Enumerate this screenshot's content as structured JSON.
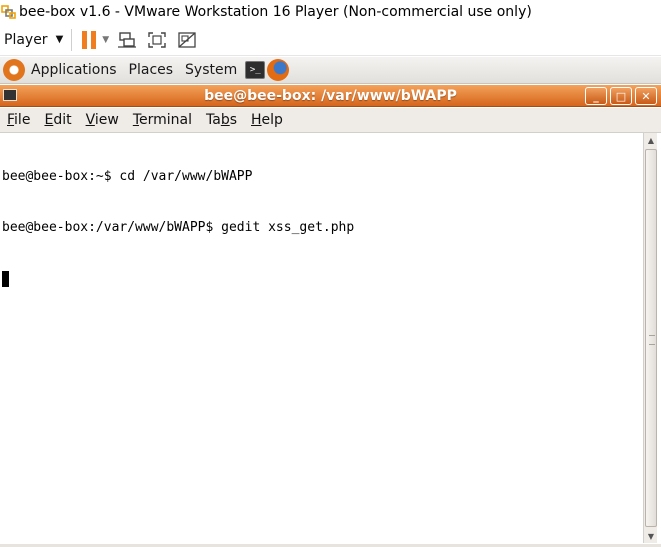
{
  "vm": {
    "title": "bee-box v1.6 - VMware Workstation 16 Player (Non-commercial use only)",
    "player_label": "Player",
    "icons": {
      "logo": "vmware-logo-icon",
      "pause": "pause-icon",
      "send_keys": "send-ctrl-alt-del-icon",
      "fullscreen": "fullscreen-icon",
      "unity": "unity-icon"
    },
    "accent_color": "#f07d1e"
  },
  "gnome_panel": {
    "applications": "Applications",
    "places": "Places",
    "system": "System",
    "terminal_launcher_glyph": ">_"
  },
  "terminal": {
    "title": "bee@bee-box: /var/www/bWAPP",
    "titlebar_color": "#e07a2c",
    "menu": [
      {
        "pre": "",
        "key": "F",
        "post": "ile"
      },
      {
        "pre": "",
        "key": "E",
        "post": "dit"
      },
      {
        "pre": "",
        "key": "V",
        "post": "iew"
      },
      {
        "pre": "",
        "key": "T",
        "post": "erminal"
      },
      {
        "pre": "Ta",
        "key": "b",
        "post": "s"
      },
      {
        "pre": "",
        "key": "H",
        "post": "elp"
      }
    ],
    "lines": [
      "bee@bee-box:~$ cd /var/www/bWAPP",
      "bee@bee-box:/var/www/bWAPP$ gedit xss_get.php"
    ],
    "wm_buttons": {
      "minimize": "_",
      "maximize": "□",
      "close": "✕"
    }
  }
}
